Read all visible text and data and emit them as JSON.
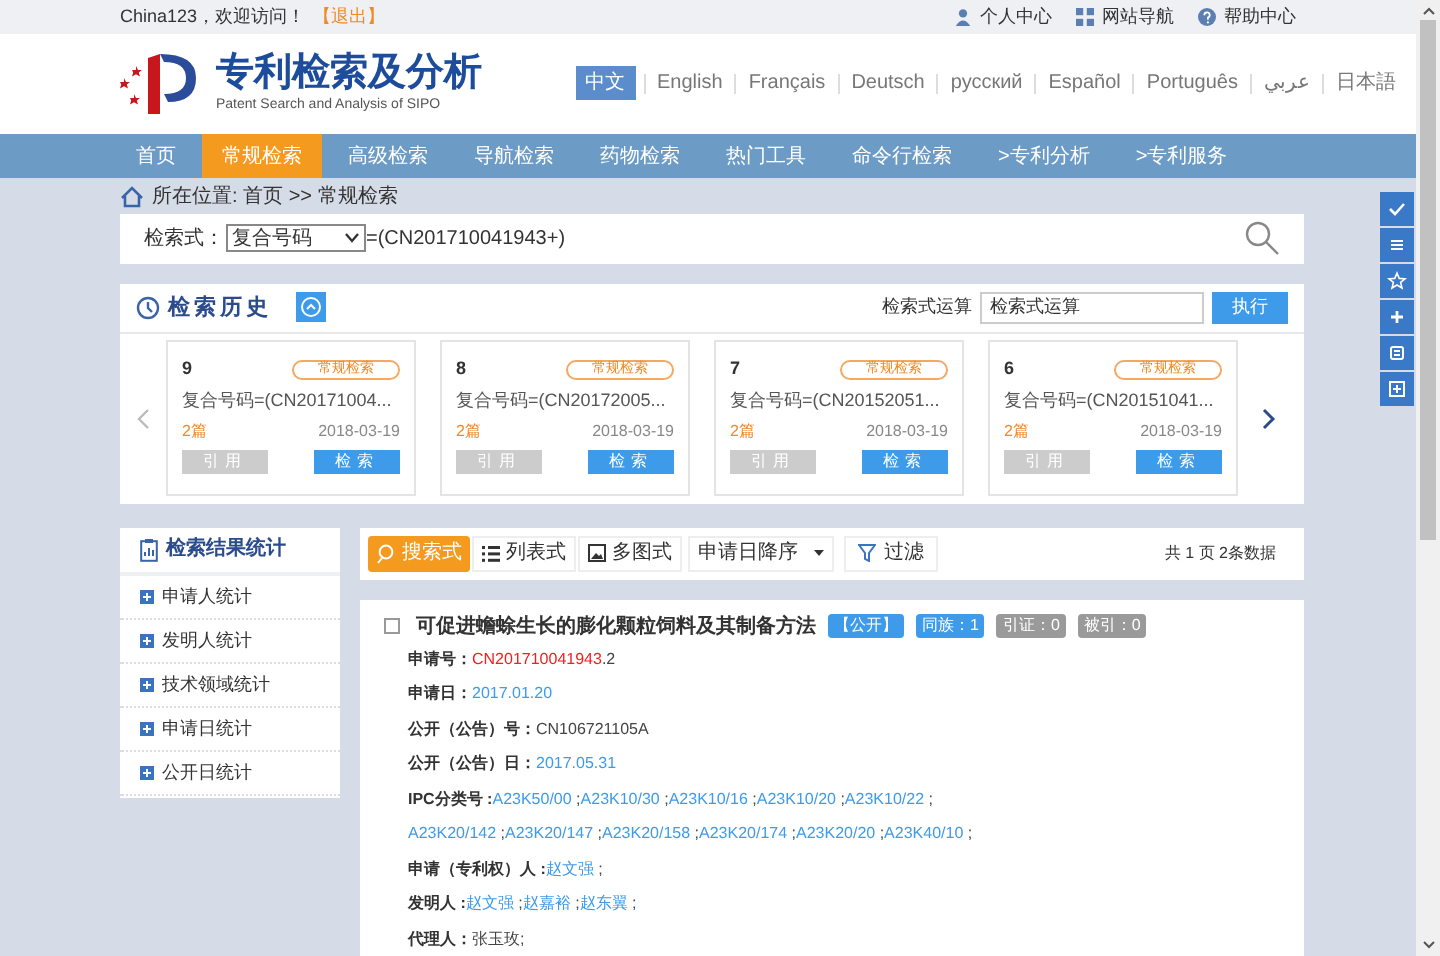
{
  "top_bar": {
    "welcome": "China123，欢迎访问！",
    "logout": "【退出】",
    "links": [
      {
        "label": "个人中心",
        "kind": "user"
      },
      {
        "label": "网站导航",
        "kind": "grid"
      },
      {
        "label": "帮助中心",
        "kind": "help"
      }
    ]
  },
  "header": {
    "title": "专利检索及分析",
    "subtitle": "Patent Search and Analysis of SIPO",
    "languages": [
      {
        "label": "中文",
        "selected": true
      },
      {
        "label": "English",
        "selected": false
      },
      {
        "label": "Français",
        "selected": false
      },
      {
        "label": "Deutsch",
        "selected": false
      },
      {
        "label": "русский",
        "selected": false
      },
      {
        "label": "Español",
        "selected": false
      },
      {
        "label": "Português",
        "selected": false
      },
      {
        "label": "عربي",
        "selected": false
      },
      {
        "label": "日本語",
        "selected": false
      }
    ]
  },
  "nav": [
    {
      "label": "首页",
      "selected": false
    },
    {
      "label": "常规检索",
      "selected": true
    },
    {
      "label": "高级检索",
      "selected": false
    },
    {
      "label": "导航检索",
      "selected": false
    },
    {
      "label": "药物检索",
      "selected": false
    },
    {
      "label": "热门工具",
      "selected": false
    },
    {
      "label": "命令行检索",
      "selected": false
    },
    {
      "label": ">专利分析",
      "selected": false
    },
    {
      "label": ">专利服务",
      "selected": false
    }
  ],
  "breadcrumb": "所在位置: 首页 >> 常规检索",
  "search": {
    "label": "检索式：",
    "field": "复合号码",
    "query": "=(CN201710041943+)"
  },
  "history": {
    "title": "检索历史",
    "operation_label": "检索式运算",
    "operation_value": "检索式运算",
    "execute": "执行",
    "cards": [
      {
        "number": "9",
        "tag": "常规检索",
        "query": "复合号码=(CN20171004...",
        "count": "2篇",
        "date": "2018-03-19",
        "cite": "引用",
        "search": "检索"
      },
      {
        "number": "8",
        "tag": "常规检索",
        "query": "复合号码=(CN20172005...",
        "count": "2篇",
        "date": "2018-03-19",
        "cite": "引用",
        "search": "检索"
      },
      {
        "number": "7",
        "tag": "常规检索",
        "query": "复合号码=(CN20152051...",
        "count": "2篇",
        "date": "2018-03-19",
        "cite": "引用",
        "search": "检索"
      },
      {
        "number": "6",
        "tag": "常规检索",
        "query": "复合号码=(CN20151041...",
        "count": "2篇",
        "date": "2018-03-19",
        "cite": "引用",
        "search": "检索"
      }
    ]
  },
  "stats": {
    "title": "检索结果统计",
    "items": [
      "申请人统计",
      "发明人统计",
      "技术领域统计",
      "申请日统计",
      "公开日统计"
    ]
  },
  "toolbar": {
    "views": [
      {
        "label": "搜索式",
        "selected": true,
        "kind": "search"
      },
      {
        "label": "列表式",
        "selected": false,
        "kind": "list"
      },
      {
        "label": "多图式",
        "selected": false,
        "kind": "image"
      }
    ],
    "sort": "申请日降序",
    "filter": "过滤",
    "summary": "共 1 页 2条数据"
  },
  "result": {
    "checked": false,
    "title": "可促进蟾蜍生长的膨化颗粒饲料及其制备方法",
    "badges": [
      {
        "label": "【公开】",
        "disabled": false
      },
      {
        "label": "同族：1",
        "disabled": false
      },
      {
        "label": "引证：0",
        "disabled": true
      },
      {
        "label": "被引：0",
        "disabled": true
      }
    ],
    "fields": [
      {
        "label": "申请号：",
        "values": [
          {
            "text": "CN201710041943",
            "kind": "highlight"
          },
          {
            "text": ".2",
            "kind": "plain"
          }
        ]
      },
      {
        "label": "申请日：",
        "values": [
          {
            "text": "2017.01.20",
            "kind": "link"
          }
        ]
      },
      {
        "label": "公开（公告）号：",
        "values": [
          {
            "text": "CN106721105A",
            "kind": "plain"
          }
        ]
      },
      {
        "label": "公开（公告）日：",
        "values": [
          {
            "text": "2017.05.31",
            "kind": "link"
          }
        ]
      },
      {
        "label": "IPC分类号 :",
        "values": [
          {
            "text": "A23K50/00",
            "kind": "link"
          },
          {
            "text": " ;",
            "kind": "plain"
          },
          {
            "text": "A23K10/30",
            "kind": "link"
          },
          {
            "text": " ;",
            "kind": "plain"
          },
          {
            "text": "A23K10/16",
            "kind": "link"
          },
          {
            "text": " ;",
            "kind": "plain"
          },
          {
            "text": "A23K10/20",
            "kind": "link"
          },
          {
            "text": " ;",
            "kind": "plain"
          },
          {
            "text": "A23K10/22",
            "kind": "link"
          },
          {
            "text": " ;",
            "kind": "plain"
          },
          {
            "text": "A23K20/142",
            "kind": "link"
          },
          {
            "text": " ;",
            "kind": "plain"
          },
          {
            "text": "A23K20/147",
            "kind": "link"
          },
          {
            "text": " ;",
            "kind": "plain"
          },
          {
            "text": "A23K20/158",
            "kind": "link"
          },
          {
            "text": " ;",
            "kind": "plain"
          },
          {
            "text": "A23K20/174",
            "kind": "link"
          },
          {
            "text": " ;",
            "kind": "plain"
          },
          {
            "text": "A23K20/20",
            "kind": "link"
          },
          {
            "text": " ;",
            "kind": "plain"
          },
          {
            "text": "A23K40/10",
            "kind": "link"
          },
          {
            "text": " ;",
            "kind": "plain"
          }
        ]
      },
      {
        "label": "申请（专利权）人 :",
        "values": [
          {
            "text": "赵文强",
            "kind": "link"
          },
          {
            "text": " ;",
            "kind": "plain"
          }
        ]
      },
      {
        "label": "发明人 :",
        "values": [
          {
            "text": "赵文强",
            "kind": "link"
          },
          {
            "text": " ;",
            "kind": "plain"
          },
          {
            "text": "赵嘉裕",
            "kind": "link"
          },
          {
            "text": " ;",
            "kind": "plain"
          },
          {
            "text": "赵东翼",
            "kind": "link"
          },
          {
            "text": " ;",
            "kind": "plain"
          }
        ]
      },
      {
        "label": "代理人：",
        "values": [
          {
            "text": "张玉玫;",
            "kind": "plain"
          }
        ]
      }
    ]
  }
}
